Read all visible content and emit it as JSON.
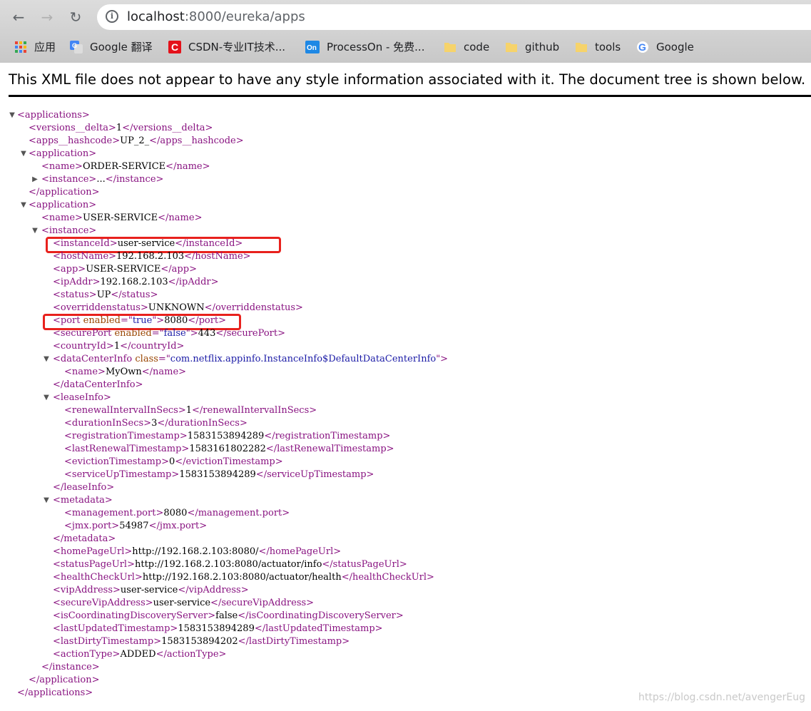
{
  "browser": {
    "url_host": "localhost",
    "url_rest": ":8000/eureka/apps",
    "bookmarks": [
      {
        "label": "应用",
        "icon": "apps-grid-icon"
      },
      {
        "label": "Google 翻译",
        "icon": "google-translate-icon"
      },
      {
        "label": "CSDN-专业IT技术...",
        "icon": "csdn-icon"
      },
      {
        "label": "ProcessOn - 免费...",
        "icon": "processon-icon"
      },
      {
        "label": "code",
        "icon": "folder-icon"
      },
      {
        "label": "github",
        "icon": "folder-icon"
      },
      {
        "label": "tools",
        "icon": "folder-icon"
      },
      {
        "label": "Google",
        "icon": "google-icon"
      }
    ]
  },
  "banner": "This XML file does not appear to have any style information associated with it. The document tree is shown below.",
  "xml": {
    "root_open": "<applications>",
    "root_close": "</applications>",
    "versions_delta": "1",
    "apps_hashcode": "UP_2_",
    "app1_name": "ORDER-SERVICE",
    "app1_instance_collapsed": "...",
    "app2_name": "USER-SERVICE",
    "instanceId": "user-service",
    "hostName": "192.168.2.103",
    "app": "USER-SERVICE",
    "ipAddr": "192.168.2.103",
    "status": "UP",
    "overriddenstatus": "UNKNOWN",
    "port_enabled": "true",
    "port": "8080",
    "securePort_enabled": "false",
    "securePort": "443",
    "countryId": "1",
    "dataCenterInfo_class": "com.netflix.appinfo.InstanceInfo$DefaultDataCenterInfo",
    "dataCenter_name": "MyOwn",
    "renewalIntervalInSecs": "1",
    "durationInSecs": "3",
    "registrationTimestamp": "1583153894289",
    "lastRenewalTimestamp": "1583161802282",
    "evictionTimestamp": "0",
    "serviceUpTimestamp": "1583153894289",
    "management_port": "8080",
    "jmx_port": "54987",
    "homePageUrl": "http://192.168.2.103:8080/",
    "statusPageUrl": "http://192.168.2.103:8080/actuator/info",
    "healthCheckUrl": "http://192.168.2.103:8080/actuator/health",
    "vipAddress": "user-service",
    "secureVipAddress": "user-service",
    "isCoordinatingDiscoveryServer": "false",
    "lastUpdatedTimestamp": "1583153894289",
    "lastDirtyTimestamp": "1583153894202",
    "actionType": "ADDED"
  },
  "watermark": "https://blog.csdn.net/avengerEug",
  "colors": {
    "tag": "#881280",
    "attr_name": "#994500",
    "attr_value": "#1a1aa6",
    "highlight": "#e8211d"
  }
}
